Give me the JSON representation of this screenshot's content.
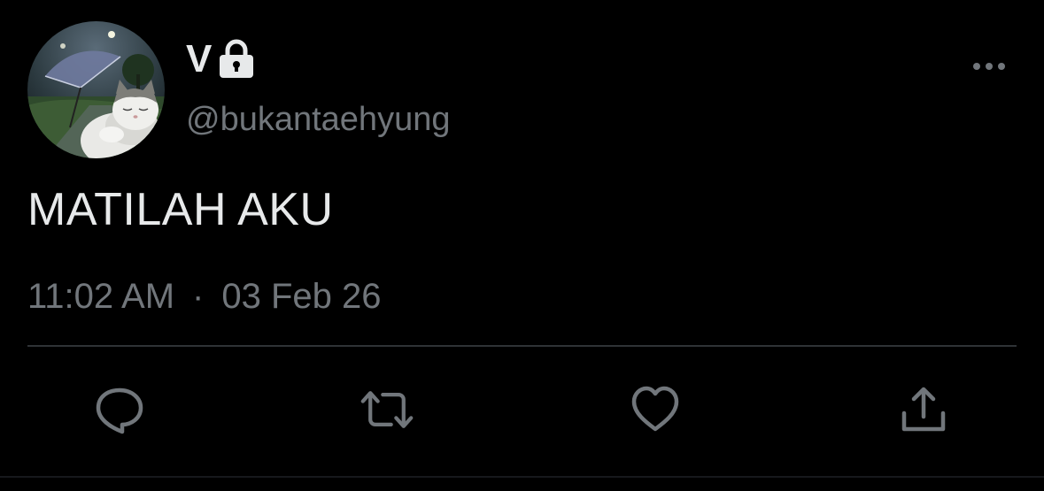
{
  "tweet": {
    "display_name": "V",
    "handle": "@bukantaehyung",
    "text": "MATILAH AKU",
    "time": "11:02 AM",
    "separator": "·",
    "date": "03 Feb 26",
    "protected_icon": "lock-icon",
    "avatar_description_icon": "avatar-image"
  },
  "actions": {
    "reply_icon": "reply-icon",
    "retweet_icon": "retweet-icon",
    "like_icon": "heart-icon",
    "share_icon": "share-icon",
    "more_icon": "more-icon"
  },
  "colors": {
    "background": "#000000",
    "primary_text": "#e7e9ea",
    "secondary_text": "#71767b",
    "divider": "#2f3336"
  }
}
